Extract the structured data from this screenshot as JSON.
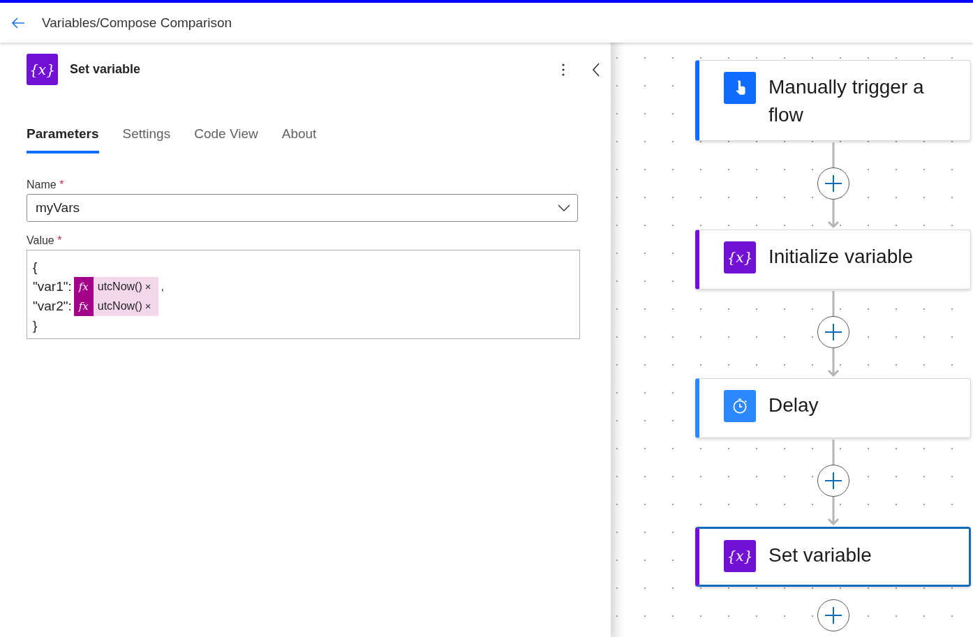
{
  "header": {
    "title": "Variables/Compose Comparison"
  },
  "panel": {
    "title": "Set variable",
    "glyph": "{x}",
    "tabs": [
      {
        "label": "Parameters",
        "selected": true
      },
      {
        "label": "Settings",
        "selected": false
      },
      {
        "label": "Code View",
        "selected": false
      },
      {
        "label": "About",
        "selected": false
      }
    ],
    "name_field": {
      "label": "Name",
      "required_mark": "*",
      "value": "myVars"
    },
    "value_field": {
      "label": "Value",
      "required_mark": "*",
      "lines": [
        {
          "text": "{"
        },
        {
          "text": "\"var1\":",
          "token": {
            "icon": "fx",
            "label": "utcNow()",
            "remove": "×"
          },
          "after": ","
        },
        {
          "text": "\"var2\":",
          "token": {
            "icon": "fx",
            "label": "utcNow()",
            "remove": "×"
          }
        },
        {
          "text": "}"
        }
      ]
    }
  },
  "flow": {
    "nodes": [
      {
        "kind": "trigger",
        "title": "Manually trigger a flow",
        "color": "#0f6cff",
        "selected": false
      },
      {
        "kind": "variable",
        "glyph": "{x}",
        "title": "Initialize variable",
        "color": "#7211d6",
        "selected": false
      },
      {
        "kind": "delay",
        "title": "Delay",
        "color": "#2b88ff",
        "selected": false
      },
      {
        "kind": "variable",
        "glyph": "{x}",
        "title": "Set variable",
        "color": "#7211d6",
        "selected": true
      }
    ]
  }
}
